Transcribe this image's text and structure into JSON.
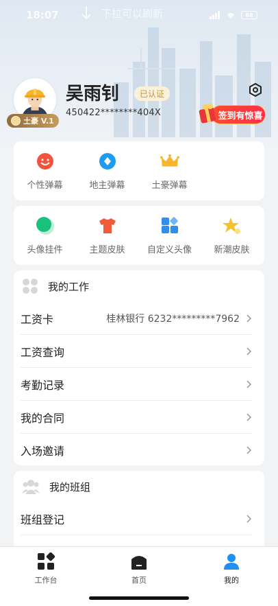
{
  "status_bar": {
    "time": "18:07",
    "battery": "68"
  },
  "pull_hint": "下拉可以刷新",
  "profile": {
    "name": "吴雨钊",
    "verified": "已认证",
    "id_number": "450422********404X",
    "level_badge": "土豪 V.1",
    "checkin_label": "签到有惊喜"
  },
  "barrage": [
    {
      "label": "个性弹幕",
      "icon": "smile-icon",
      "color": "#f2553b"
    },
    {
      "label": "地主弹幕",
      "icon": "diamond-icon",
      "color": "#1f9cf0"
    },
    {
      "label": "土豪弹幕",
      "icon": "crown-icon",
      "color": "#f6b52a"
    }
  ],
  "decor": [
    {
      "label": "头像挂件",
      "icon": "circle-icon",
      "color": "#18c27b"
    },
    {
      "label": "主题皮肤",
      "icon": "tshirt-icon",
      "color": "#f25b3a"
    },
    {
      "label": "自定义头像",
      "icon": "grid-icon",
      "color": "#2f8ff0"
    },
    {
      "label": "新潮皮肤",
      "icon": "star-icon",
      "color": "#f6c22a"
    }
  ],
  "my_work": {
    "title": "我的工作",
    "items": [
      {
        "label": "工资卡",
        "value": "桂林银行 6232*********7962"
      },
      {
        "label": "工资查询",
        "value": ""
      },
      {
        "label": "考勤记录",
        "value": ""
      },
      {
        "label": "我的合同",
        "value": ""
      },
      {
        "label": "入场邀请",
        "value": ""
      }
    ]
  },
  "my_team": {
    "title": "我的班组",
    "items": [
      {
        "label": "班组登记",
        "value": ""
      }
    ]
  },
  "bottom_nav": [
    {
      "label": "工作台",
      "icon": "workbench-icon"
    },
    {
      "label": "首页",
      "icon": "home-icon"
    },
    {
      "label": "我的",
      "icon": "profile-icon",
      "active": true
    }
  ]
}
